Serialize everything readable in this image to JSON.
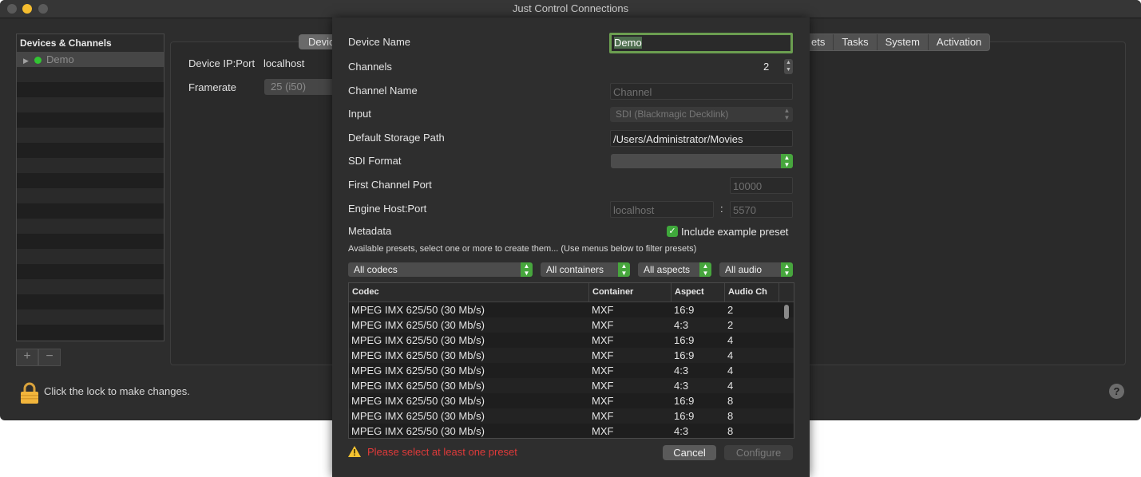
{
  "window": {
    "title": "Just Control Connections"
  },
  "sidebar": {
    "header": "Devices & Channels",
    "items": [
      {
        "label": "Demo",
        "status_color": "#32c433"
      }
    ]
  },
  "toolbar": {
    "add_label": "+",
    "remove_label": "−"
  },
  "device_panel": {
    "ip_label": "Device IP:Port",
    "ip_value": "localhost",
    "framerate_label": "Framerate",
    "framerate_value": "25 (i50)",
    "tab_device": "Devic",
    "tabs": [
      "ets",
      "Tasks",
      "System",
      "Activation"
    ]
  },
  "footer": {
    "lock_text": "Click the lock to make changes.",
    "help_label": "?"
  },
  "sheet": {
    "device_name_label": "Device Name",
    "device_name_value": "Demo",
    "channels_label": "Channels",
    "channels_value": "2",
    "channel_name_label": "Channel Name",
    "channel_name_placeholder": "Channel",
    "input_label": "Input",
    "input_value": "SDI (Blackmagic Decklink)",
    "storage_label": "Default Storage Path",
    "storage_value": "/Users/Administrator/Movies",
    "sdi_label": "SDI Format",
    "sdi_value": "",
    "first_port_label": "First Channel Port",
    "first_port_placeholder": "10000",
    "engine_label": "Engine Host:Port",
    "engine_host_placeholder": "localhost",
    "engine_sep": ":",
    "engine_port_placeholder": "5570",
    "metadata_label": "Metadata",
    "include_preset_label": "Include example preset",
    "include_preset_checked": true,
    "presets_hint": "Available presets, select one or more to create them... (Use menus below to filter presets)",
    "filters": {
      "codecs": "All codecs",
      "containers": "All containers",
      "aspects": "All aspects",
      "audio": "All audio"
    },
    "table": {
      "columns": [
        "Codec",
        "Container",
        "Aspect",
        "Audio Ch"
      ],
      "rows": [
        [
          "MPEG IMX 625/50 (30 Mb/s)",
          "MXF",
          "16:9",
          "2"
        ],
        [
          "MPEG IMX 625/50 (30 Mb/s)",
          "MXF",
          "4:3",
          "2"
        ],
        [
          "MPEG IMX 625/50 (30 Mb/s)",
          "MXF",
          "16:9",
          "4"
        ],
        [
          "MPEG IMX 625/50 (30 Mb/s)",
          "MXF",
          "16:9",
          "4"
        ],
        [
          "MPEG IMX 625/50 (30 Mb/s)",
          "MXF",
          "4:3",
          "4"
        ],
        [
          "MPEG IMX 625/50 (30 Mb/s)",
          "MXF",
          "4:3",
          "4"
        ],
        [
          "MPEG IMX 625/50 (30 Mb/s)",
          "MXF",
          "16:9",
          "8"
        ],
        [
          "MPEG IMX 625/50 (30 Mb/s)",
          "MXF",
          "16:9",
          "8"
        ],
        [
          "MPEG IMX 625/50 (30 Mb/s)",
          "MXF",
          "4:3",
          "8"
        ]
      ]
    },
    "warning_text": "Please select at least one preset",
    "warning_color": "#e03a3a",
    "cancel_label": "Cancel",
    "configure_label": "Configure"
  },
  "colors": {
    "accent_green": "#47a63d",
    "focus_ring": "#6b9e50"
  }
}
